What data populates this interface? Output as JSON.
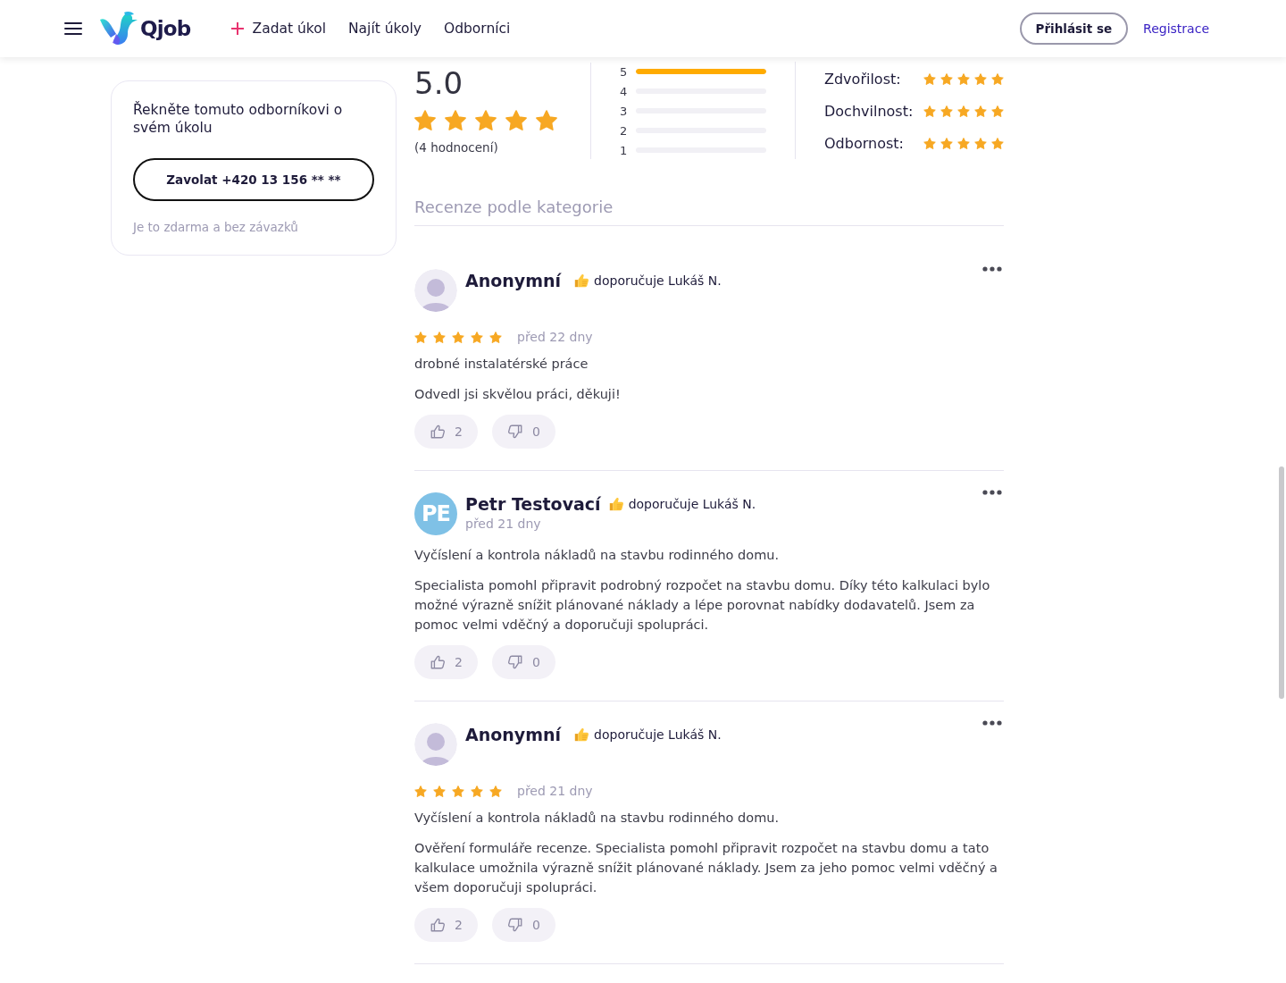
{
  "header": {
    "logo_text": "Qjob",
    "nav": [
      {
        "label": "Zadat úkol",
        "kind": "add"
      },
      {
        "label": "Najít úkoly",
        "kind": "link"
      },
      {
        "label": "Odborníci",
        "kind": "link"
      }
    ],
    "login_button": "Přihlásit se",
    "register_link": "Registrace"
  },
  "contact_card": {
    "prompt": "Řekněte tomuto odborníkovi o svém úkolu",
    "call_button": "Zavolat +420 13 156 ** **",
    "note": "Je to zdarma a bez závazků"
  },
  "rating_summary": {
    "score": "5.0",
    "stars": 5,
    "count": "(4 hodnocení)",
    "distribution": [
      {
        "label": "5",
        "level": 1
      },
      {
        "label": "4",
        "level": 0
      },
      {
        "label": "3",
        "level": 0
      },
      {
        "label": "2",
        "level": 0
      },
      {
        "label": "1",
        "level": 0
      }
    ],
    "categories": [
      {
        "label": "Zdvořilost:",
        "stars": 5
      },
      {
        "label": "Dochvilnost:",
        "stars": 5
      },
      {
        "label": "Odbornost:",
        "stars": 5
      }
    ]
  },
  "reviews_heading": "Recenze podle kategorie",
  "reviews": [
    {
      "avatar": {
        "kind": "silhouette"
      },
      "author": "Anonymní",
      "recommendation": "doporučuje Lukáš N.",
      "stars": 5,
      "date": "před 22 dny",
      "title": "drobné instalatérské práce",
      "text": "Odvedl jsi skvělou práci, děkuji!",
      "likes": "2",
      "dislikes": "0"
    },
    {
      "avatar": {
        "kind": "initials",
        "initials": "PE"
      },
      "author": "Petr Testovací",
      "recommendation": "doporučuje Lukáš N.",
      "date": "před 21 dny",
      "title": "Vyčíslení a kontrola nákladů na stavbu rodinného domu.",
      "text": "Specialista pomohl připravit podrobný rozpočet na stavbu domu. Díky této kalkulaci bylo možné výrazně snížit plánované náklady a lépe porovnat nabídky dodavatelů. Jsem za pomoc velmi vděčný a doporučuji spolupráci.",
      "likes": "2",
      "dislikes": "0"
    },
    {
      "avatar": {
        "kind": "silhouette"
      },
      "author": "Anonymní",
      "recommendation": "doporučuje Lukáš N.",
      "stars": 5,
      "date": "před 21 dny",
      "title": "Vyčíslení a kontrola nákladů na stavbu rodinného domu.",
      "text": "Ověření formuláře recenze. Specialista pomohl připravit rozpočet na stavbu domu a tato kalkulace umožnila výrazně snížit plánované náklady. Jsem za jeho pomoc velmi vděčný a všem doporučuji spolupráci.",
      "likes": "2",
      "dislikes": "0"
    }
  ]
}
